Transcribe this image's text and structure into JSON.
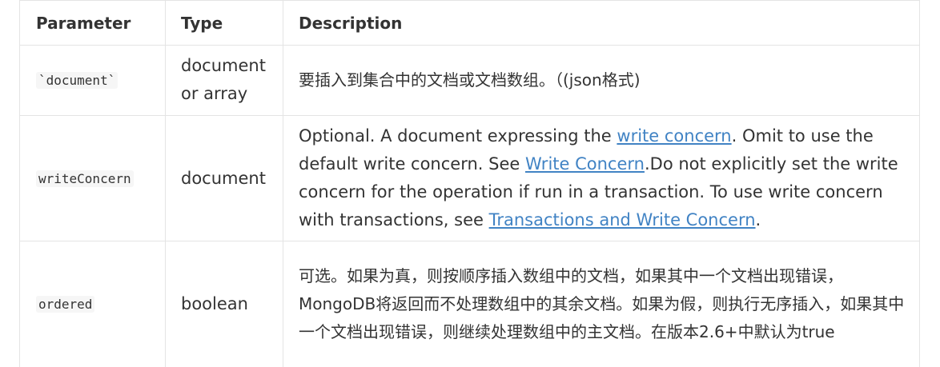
{
  "table": {
    "headers": {
      "parameter": "Parameter",
      "type": "Type",
      "description": "Description"
    },
    "rows": [
      {
        "param": "`document`",
        "type_line1": "document",
        "type_line2": "or array",
        "description": "要插入到集合中的文档或文档数组。（(json格式)"
      },
      {
        "param": "writeConcern",
        "type": "document",
        "description": {
          "t1": "Optional. A document expressing the ",
          "link1": "write concern",
          "t2": ". Omit to use the default write concern. See ",
          "link2": "Write Concern",
          "t3": ".Do not explicitly set the write concern for the operation if run in a transaction. To use write concern with transactions, see ",
          "link3": "Transactions and Write Concern",
          "t4": "."
        }
      },
      {
        "param": "ordered",
        "type": "boolean",
        "description": "可选。如果为真，则按顺序插入数组中的文档，如果其中一个文档出现错误，MongoDB将返回而不处理数组中的其余文档。如果为假，则执行无序插入，如果其中一个文档出现错误，则继续处理数组中的主文档。在版本2.6+中默认为true"
      }
    ]
  }
}
